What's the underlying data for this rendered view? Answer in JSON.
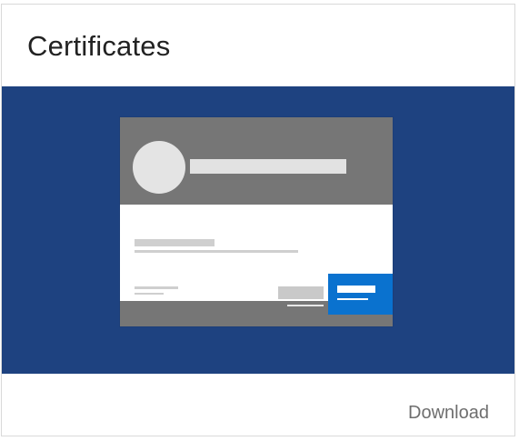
{
  "card": {
    "title": "Certificates",
    "download_label": "Download"
  },
  "colors": {
    "banner": "#1e4280",
    "accent_button": "#0a72cf",
    "illustration_gray": "#767676"
  },
  "icons": {
    "banner_illustration": "certificate-illustration-icon"
  }
}
